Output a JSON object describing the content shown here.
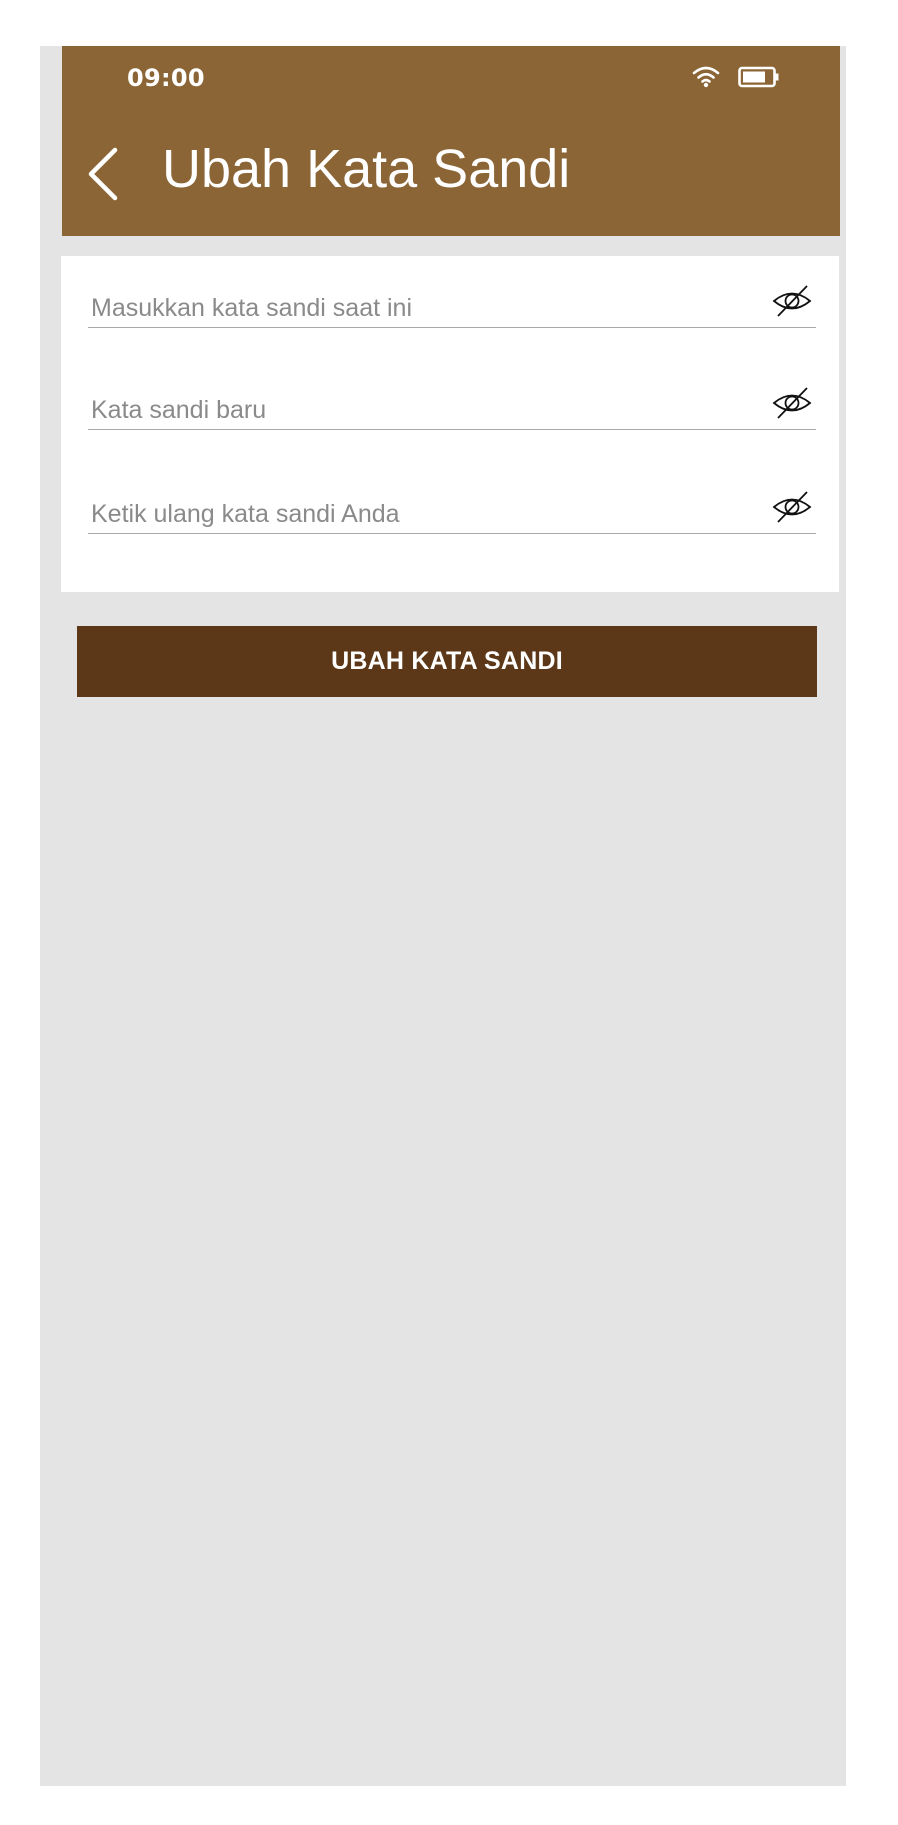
{
  "status_bar": {
    "time": "09:00",
    "wifi_icon": "wifi-icon",
    "battery_icon": "battery-icon"
  },
  "header": {
    "back_icon": "chevron-left-icon",
    "title": "Ubah Kata Sandi"
  },
  "form": {
    "fields": [
      {
        "placeholder": "Masukkan kata sandi saat ini",
        "value": "",
        "toggle_icon": "eye-slash-icon"
      },
      {
        "placeholder": "Kata sandi baru",
        "value": "",
        "toggle_icon": "eye-slash-icon"
      },
      {
        "placeholder": "Ketik ulang kata sandi Anda",
        "value": "",
        "toggle_icon": "eye-slash-icon"
      }
    ],
    "submit_label": "UBAH KATA SANDI"
  },
  "colors": {
    "header_background": "#8b6535",
    "button_background": "#5c3818",
    "page_background": "#e4e4e4",
    "card_background": "#ffffff"
  }
}
